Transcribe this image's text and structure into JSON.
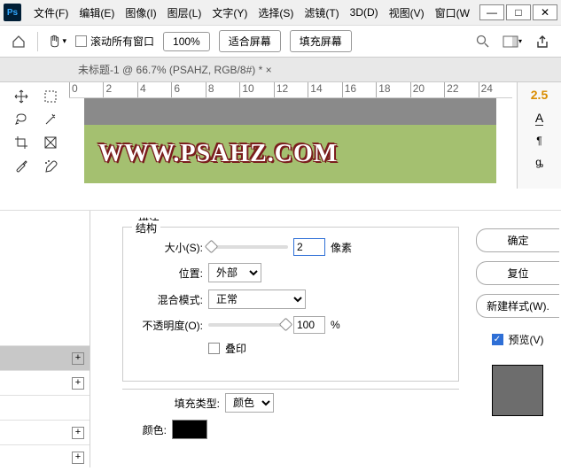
{
  "menu": {
    "file": "文件(F)",
    "edit": "编辑(E)",
    "image": "图像(I)",
    "layer": "图层(L)",
    "type": "文字(Y)",
    "select": "选择(S)",
    "filter": "滤镜(T)",
    "three_d": "3D(D)",
    "view": "视图(V)",
    "window": "窗口(W"
  },
  "options": {
    "scroll_all": "滚动所有窗口",
    "zoom": "100%",
    "fit": "适合屏幕",
    "fill": "填充屏幕"
  },
  "tab": {
    "title": "未标题-1 @ 66.7% (PSAHZ, RGB/8#) *",
    "close": "×"
  },
  "ruler": [
    "0",
    "2",
    "4",
    "6",
    "8",
    "10",
    "12",
    "14",
    "16",
    "18",
    "20",
    "22",
    "24"
  ],
  "watermark": "WWW.PSAHZ.COM",
  "char": {
    "val": "2.5",
    "a": "A"
  },
  "stroke": {
    "title": "描边",
    "structure": "结构",
    "size_label": "大小(S):",
    "size_value": "2",
    "px": "像素",
    "position_label": "位置:",
    "position_value": "外部",
    "blend_label": "混合模式:",
    "blend_value": "正常",
    "opacity_label": "不透明度(O):",
    "opacity_value": "100",
    "pct": "%",
    "overprint": "叠印",
    "fill_type_label": "填充类型:",
    "fill_type_value": "颜色",
    "color_label": "颜色:"
  },
  "buttons": {
    "ok": "确定",
    "reset": "复位",
    "new_style": "新建样式(W).",
    "preview": "预览(V)"
  }
}
